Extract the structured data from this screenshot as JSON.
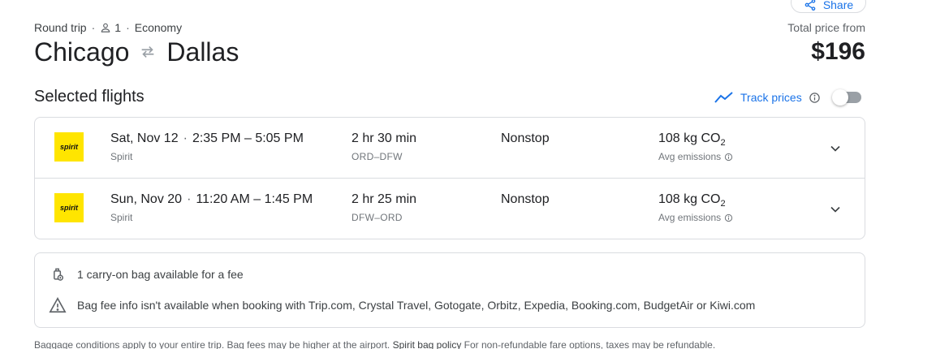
{
  "header": {
    "share_label": "Share",
    "trip_type": "Round trip",
    "passengers": "1",
    "cabin": "Economy",
    "origin": "Chicago",
    "destination": "Dallas",
    "price_label": "Total price from",
    "price": "$196"
  },
  "selected": {
    "title": "Selected flights",
    "track_prices_label": "Track prices",
    "track_enabled": false
  },
  "flights": [
    {
      "logo_text": "spirit",
      "date": "Sat, Nov 12",
      "times": "2:35 PM – 5:05 PM",
      "airline": "Spirit",
      "duration": "2 hr 30 min",
      "airports": "ORD–DFW",
      "stops": "Nonstop",
      "co2_value": "108 kg CO",
      "co2_sub": "2",
      "emissions": "Avg emissions"
    },
    {
      "logo_text": "spirit",
      "date": "Sun, Nov 20",
      "times": "11:20 AM – 1:45 PM",
      "airline": "Spirit",
      "duration": "2 hr 25 min",
      "airports": "DFW–ORD",
      "stops": "Nonstop",
      "co2_value": "108 kg CO",
      "co2_sub": "2",
      "emissions": "Avg emissions"
    }
  ],
  "baggage": {
    "carry_on": "1 carry-on bag available for a fee",
    "fee_info": "Bag fee info isn't available when booking with Trip.com, Crystal Travel, Gotogate, Orbitz, Expedia, Booking.com, BudgetAir or Kiwi.com",
    "footnote_pre": "Baggage conditions apply to your entire trip. Bag fees may be higher at the airport.",
    "policy_link": "Spirit bag policy",
    "footnote_post": "For non-refundable fare options, taxes may be refundable."
  },
  "colors": {
    "accent": "#1a73e8",
    "spirit_yellow": "#ffe500",
    "border": "#dadce0"
  }
}
